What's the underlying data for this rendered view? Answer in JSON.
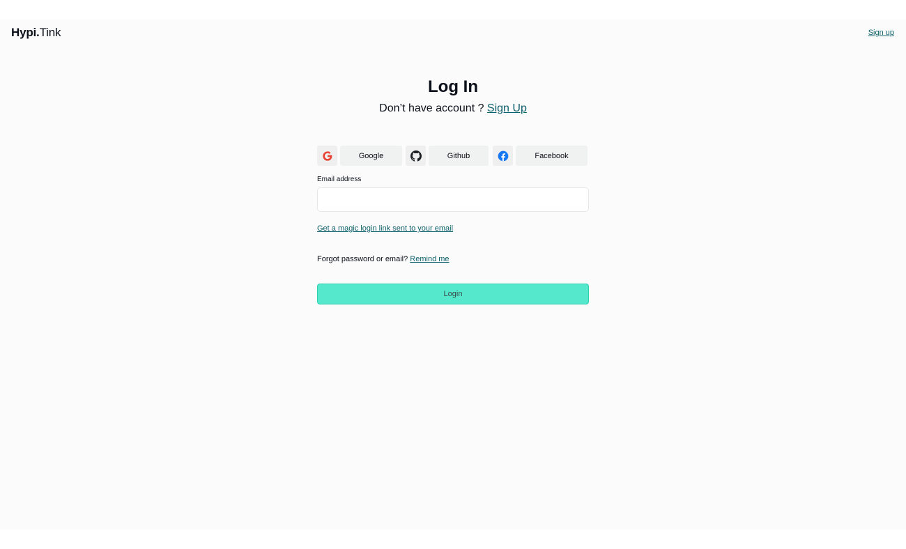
{
  "brand": {
    "name_strong": "Hypi.",
    "name_light": "Tink"
  },
  "header": {
    "signup_link": "Sign up"
  },
  "title": "Log In",
  "subtitle": {
    "text": "Don’t have account ? ",
    "link": "Sign Up"
  },
  "social": [
    {
      "label": "Google",
      "icon": "google-icon"
    },
    {
      "label": "Github",
      "icon": "github-icon"
    },
    {
      "label": "Facebook",
      "icon": "facebook-icon"
    }
  ],
  "email": {
    "label": "Email address",
    "value": "",
    "placeholder": ""
  },
  "magic_link": "Get a magic login link sent to your email",
  "forgot": {
    "text": "Forgot password or email? ",
    "link": "Remind me"
  },
  "login_button": "Login",
  "colors": {
    "accent": "#55e8cd",
    "link": "#0b5f6a",
    "google": "#ea4335",
    "facebook": "#1877f2"
  }
}
